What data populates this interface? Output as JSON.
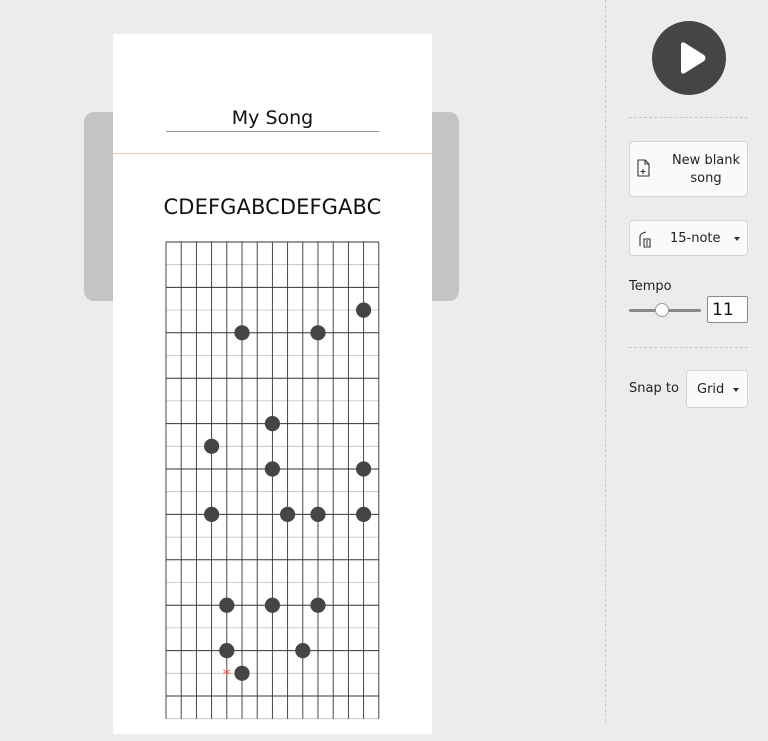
{
  "song": {
    "title": "My Song",
    "note_names": "CDEFGABCDEFGABC",
    "notes": [
      {
        "col": 13,
        "row": 3
      },
      {
        "col": 5,
        "row": 4
      },
      {
        "col": 10,
        "row": 4
      },
      {
        "col": 7,
        "row": 8
      },
      {
        "col": 3,
        "row": 9
      },
      {
        "col": 7,
        "row": 10
      },
      {
        "col": 13,
        "row": 10
      },
      {
        "col": 3,
        "row": 12
      },
      {
        "col": 8,
        "row": 12
      },
      {
        "col": 10,
        "row": 12
      },
      {
        "col": 13,
        "row": 12
      },
      {
        "col": 4,
        "row": 16
      },
      {
        "col": 7,
        "row": 16
      },
      {
        "col": 10,
        "row": 16
      },
      {
        "col": 4,
        "row": 18
      },
      {
        "col": 9,
        "row": 18
      },
      {
        "col": 5,
        "row": 19
      }
    ],
    "cursor": {
      "col": 4,
      "row": 19,
      "color": "#e05050"
    }
  },
  "sidebar": {
    "play_icon": "play-icon",
    "new_song": {
      "label": "New blank song",
      "icon": "new-file-icon"
    },
    "note_count": {
      "selected": "15-note",
      "icon": "music-box-icon"
    },
    "tempo": {
      "label": "Tempo",
      "value": "11",
      "level": 0.45
    },
    "snap": {
      "label": "Snap to",
      "selected": "Grid"
    }
  },
  "colors": {
    "background": "#ececec",
    "music_box": "#c4c4c4",
    "note": "#454545",
    "play_button": "#454545",
    "header_rule": "#f0c9a2"
  }
}
